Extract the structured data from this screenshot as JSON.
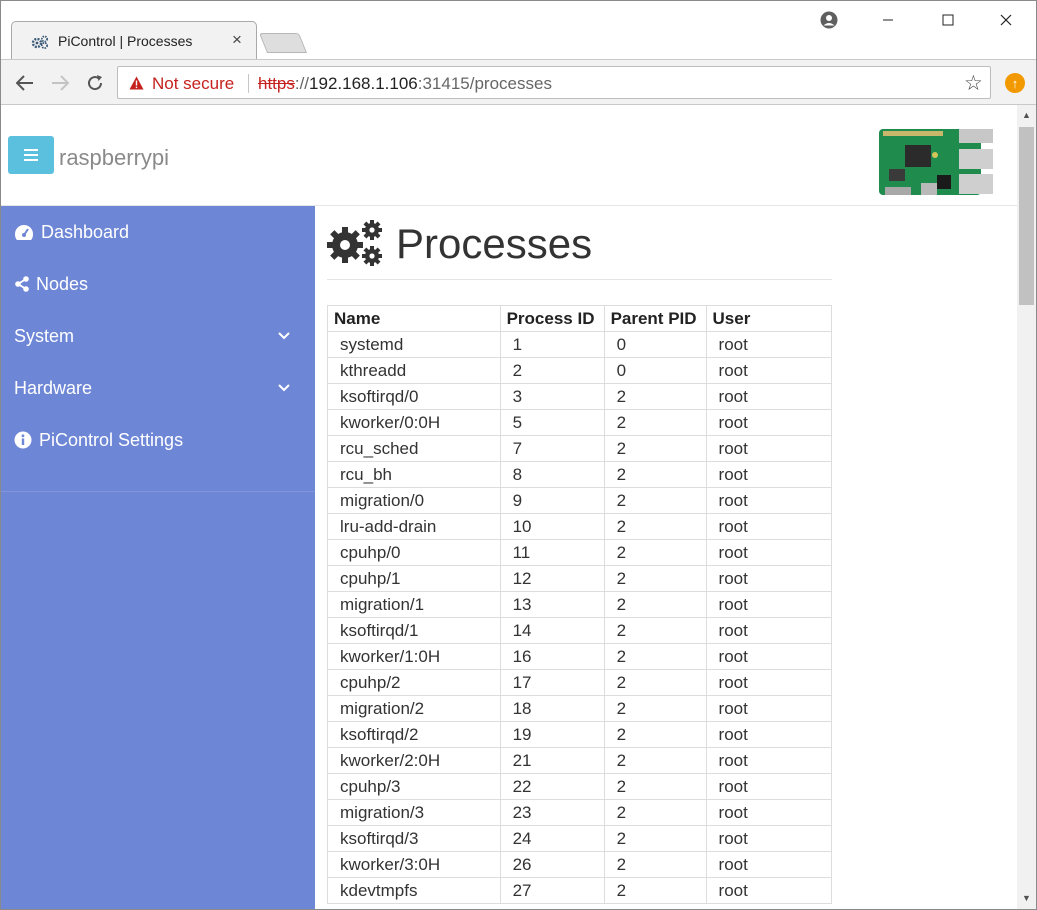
{
  "browser": {
    "tab_title": "PiControl | Processes",
    "tab_close": "×",
    "not_secure": "Not secure",
    "url_scheme": "https",
    "url_sep": "://",
    "url_host": "192.168.1.106",
    "url_rest": ":31415/processes"
  },
  "navbar": {
    "menu_glyph": "≡",
    "brand": "raspberrypi"
  },
  "sidebar": {
    "items": [
      {
        "label": "Dashboard",
        "icon": "dashboard-icon"
      },
      {
        "label": "Nodes",
        "icon": "share-icon"
      },
      {
        "label": "System",
        "icon": "chevron-down-icon"
      },
      {
        "label": "Hardware",
        "icon": "chevron-down-icon"
      },
      {
        "label": "PiControl Settings",
        "icon": "info-icon"
      }
    ]
  },
  "main": {
    "title": "Processes",
    "table": {
      "headers": [
        "Name",
        "Process ID",
        "Parent PID",
        "User"
      ],
      "rows": [
        [
          "systemd",
          "1",
          "0",
          "root"
        ],
        [
          "kthreadd",
          "2",
          "0",
          "root"
        ],
        [
          "ksoftirqd/0",
          "3",
          "2",
          "root"
        ],
        [
          "kworker/0:0H",
          "5",
          "2",
          "root"
        ],
        [
          "rcu_sched",
          "7",
          "2",
          "root"
        ],
        [
          "rcu_bh",
          "8",
          "2",
          "root"
        ],
        [
          "migration/0",
          "9",
          "2",
          "root"
        ],
        [
          "lru-add-drain",
          "10",
          "2",
          "root"
        ],
        [
          "cpuhp/0",
          "11",
          "2",
          "root"
        ],
        [
          "cpuhp/1",
          "12",
          "2",
          "root"
        ],
        [
          "migration/1",
          "13",
          "2",
          "root"
        ],
        [
          "ksoftirqd/1",
          "14",
          "2",
          "root"
        ],
        [
          "kworker/1:0H",
          "16",
          "2",
          "root"
        ],
        [
          "cpuhp/2",
          "17",
          "2",
          "root"
        ],
        [
          "migration/2",
          "18",
          "2",
          "root"
        ],
        [
          "ksoftirqd/2",
          "19",
          "2",
          "root"
        ],
        [
          "kworker/2:0H",
          "21",
          "2",
          "root"
        ],
        [
          "cpuhp/3",
          "22",
          "2",
          "root"
        ],
        [
          "migration/3",
          "23",
          "2",
          "root"
        ],
        [
          "ksoftirqd/3",
          "24",
          "2",
          "root"
        ],
        [
          "kworker/3:0H",
          "26",
          "2",
          "root"
        ],
        [
          "kdevtmpfs",
          "27",
          "2",
          "root"
        ]
      ]
    }
  },
  "colors": {
    "sidebar_bg": "#6e86d6",
    "hamburger_bg": "#5bc0de",
    "not_secure": "#c5221f"
  }
}
